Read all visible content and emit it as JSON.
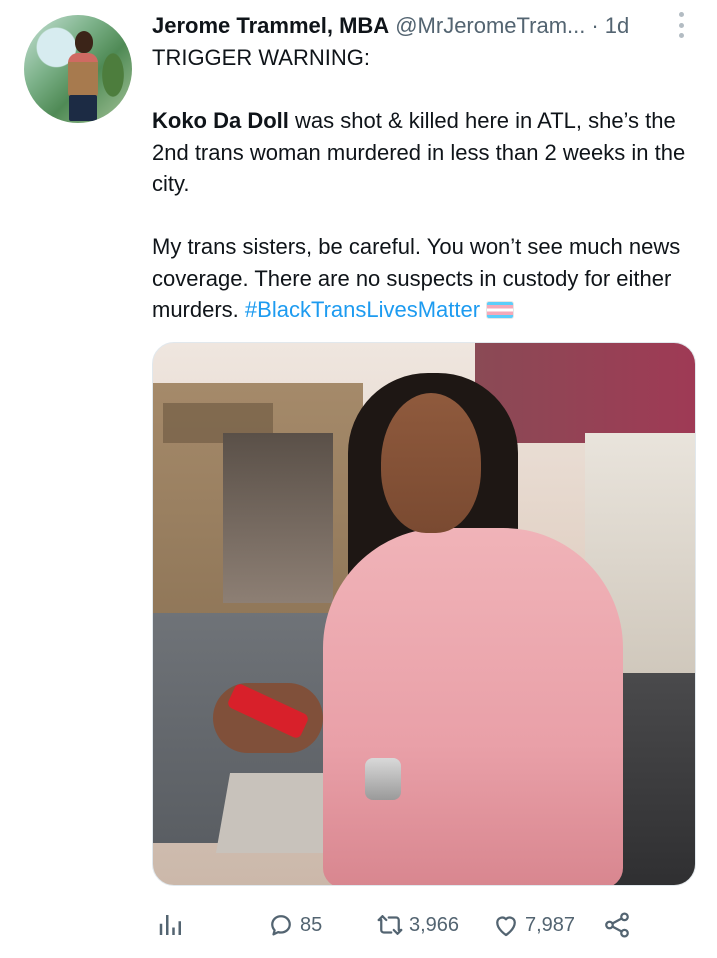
{
  "tweet": {
    "display_name": "Jerome Trammel, MBA",
    "handle": "@MrJeromeTram...",
    "separator": "·",
    "time": "1d",
    "lines": {
      "warning": "TRIGGER WARNING:",
      "victim_name": "Koko Da Doll",
      "p1_rest": " was shot & killed here in ATL, she’s the 2nd trans woman murdered in less than 2 weeks in the city.",
      "p2": "My trans sisters, be careful. You won’t see much news coverage. There are no suspects in custody for either murders. ",
      "hashtag": "#BlackTransLivesMatter"
    },
    "flag_emoji": "transgender-flag",
    "media_alt": "photo"
  },
  "actions": {
    "views_icon": "analytics-icon",
    "reply_count": "85",
    "retweet_count": "3,966",
    "like_count": "7,987",
    "share_icon": "share-icon"
  },
  "colors": {
    "text": "#0f1419",
    "secondary": "#536471",
    "link": "#1d9bf0"
  }
}
